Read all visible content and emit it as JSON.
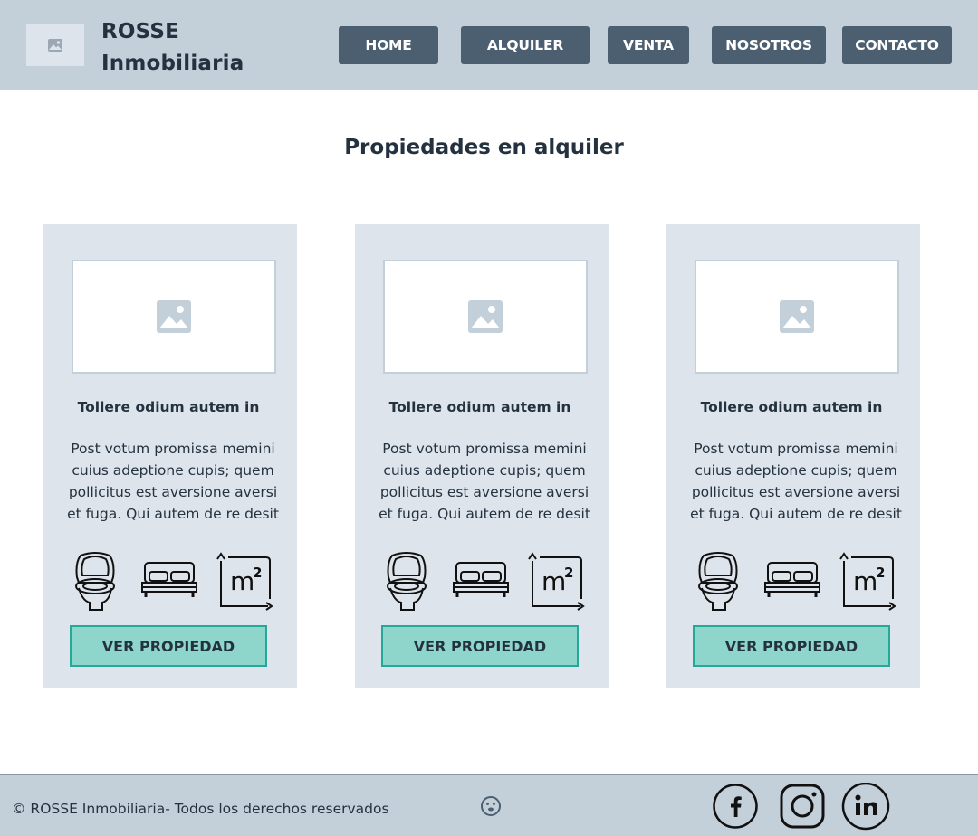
{
  "header": {
    "logo_icon": "image-placeholder-icon",
    "brand_line1": "ROSSE",
    "brand_line2": "Inmobiliaria",
    "nav": [
      {
        "label": "HOME"
      },
      {
        "label": "ALQUILER"
      },
      {
        "label": "VENTA"
      },
      {
        "label": "NOSOTROS"
      },
      {
        "label": "CONTACTO"
      }
    ]
  },
  "main": {
    "title": "Propiedades en alquiler",
    "cards": [
      {
        "image_icon": "image-placeholder-icon",
        "title": "Tollere odium autem in",
        "description": "Post votum promissa memini cuius adeptione cupis; quem pollicitus est aversione aversi et fuga. Qui autem de re desit",
        "features": [
          "toilet-icon",
          "bed-icon",
          "square-meters-icon"
        ],
        "button_label": "VER PROPIEDAD"
      },
      {
        "image_icon": "image-placeholder-icon",
        "title": "Tollere odium autem in",
        "description": "Post votum promissa memini cuius adeptione cupis; quem pollicitus est aversione aversi et fuga. Qui autem de re desit",
        "features": [
          "toilet-icon",
          "bed-icon",
          "square-meters-icon"
        ],
        "button_label": "VER PROPIEDAD"
      },
      {
        "image_icon": "image-placeholder-icon",
        "title": "Tollere odium autem in",
        "description": "Post votum promissa memini cuius adeptione cupis; quem pollicitus est aversione aversi et fuga. Qui autem de re desit",
        "features": [
          "toilet-icon",
          "bed-icon",
          "square-meters-icon"
        ],
        "button_label": "VER PROPIEDAD"
      }
    ]
  },
  "footer": {
    "copyright": "© ROSSE Inmobiliaria- Todos los derechos reservados",
    "smile_icon": "smile-icon",
    "social": [
      "facebook-icon",
      "instagram-icon",
      "linkedin-icon"
    ]
  },
  "colors": {
    "header_bg": "#c3cfd9",
    "nav_button": "#4c5f70",
    "card_bg": "#dee4ec",
    "cta_fill": "#8ed5cc",
    "cta_border": "#25a899",
    "text": "#243240"
  }
}
